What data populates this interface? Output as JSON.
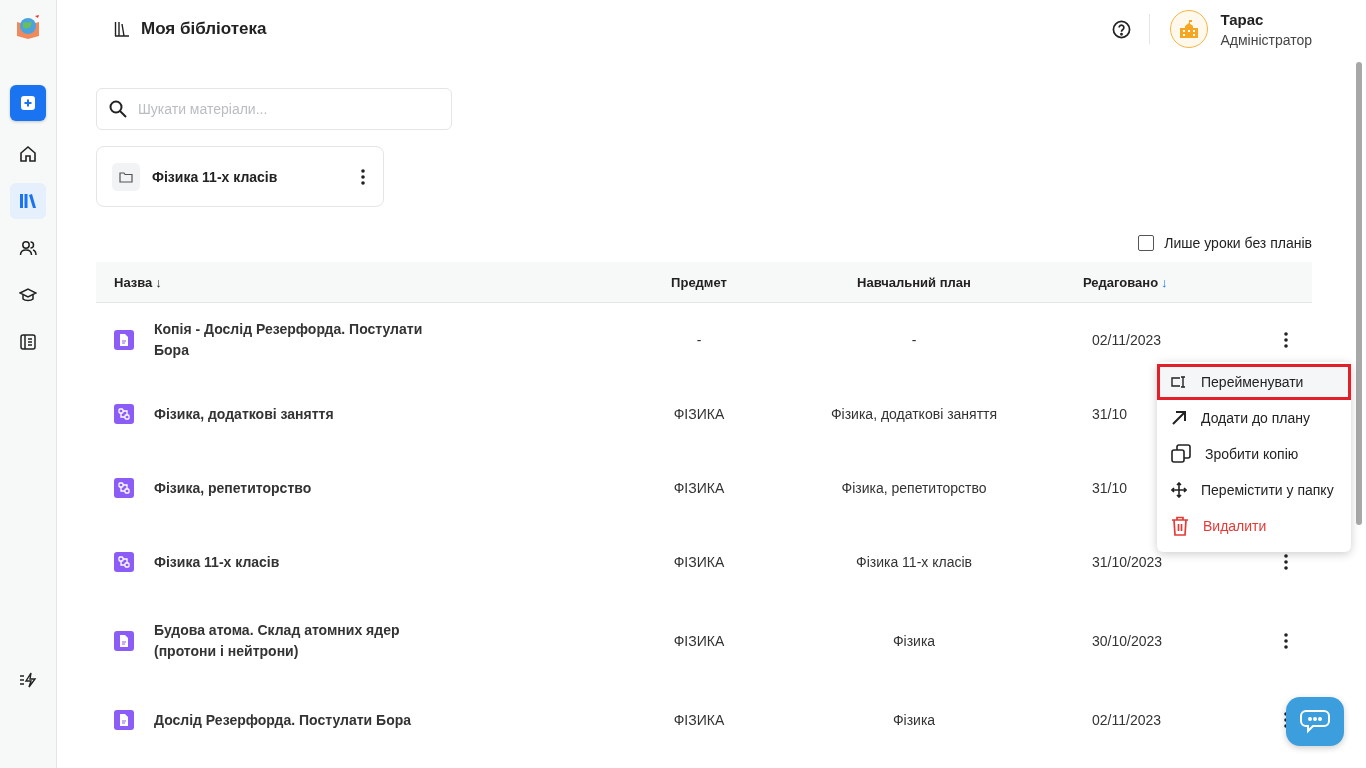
{
  "header": {
    "title": "Моя бібліотека",
    "user": {
      "name": "Тарас",
      "role": "Адміністратор"
    }
  },
  "sidebar": {
    "items": [
      {
        "kind": "add",
        "selected": false
      },
      {
        "kind": "home",
        "selected": false
      },
      {
        "kind": "library",
        "selected": true
      },
      {
        "kind": "users",
        "selected": false
      },
      {
        "kind": "courses",
        "selected": false
      },
      {
        "kind": "journal",
        "selected": false
      }
    ]
  },
  "search": {
    "placeholder": "Шукати матеріали..."
  },
  "folders": [
    {
      "name": "Фізика 11-х класів"
    }
  ],
  "filter": {
    "label": "Лише уроки без планів",
    "checked": false
  },
  "table": {
    "columns": [
      {
        "label": "Назва",
        "sort_arrow": "↓",
        "active": false
      },
      {
        "label": "Предмет"
      },
      {
        "label": "Навчальний план"
      },
      {
        "label": "Редаговано",
        "sort_arrow": "↓",
        "active": true
      }
    ],
    "rows": [
      {
        "kind": "doc",
        "name": "Копія - Дослід Резерфорда. Постулати Бора",
        "subject": "-",
        "plan": "-",
        "edited": "02/11/2023"
      },
      {
        "kind": "plan",
        "name": "Фізика, додаткові заняття",
        "subject": "ФІЗИКА",
        "plan": "Фізика, додаткові заняття",
        "edited": "31/10"
      },
      {
        "kind": "plan",
        "name": "Фізика, репетиторство",
        "subject": "ФІЗИКА",
        "plan": "Фізика, репетиторство",
        "edited": "31/10"
      },
      {
        "kind": "plan",
        "name": "Фізика 11-х класів",
        "subject": "ФІЗИКА",
        "plan": "Фізика 11-х класів",
        "edited": "31/10/2023"
      },
      {
        "kind": "doc",
        "name": "Будова атома. Склад атомних ядер (протони і нейтрони)",
        "subject": "ФІЗИКА",
        "plan": "Фізика",
        "edited": "30/10/2023"
      },
      {
        "kind": "doc",
        "name": "Дослід Резерфорда. Постулати Бора",
        "subject": "ФІЗИКА",
        "plan": "Фізика",
        "edited": "02/11/2023"
      }
    ]
  },
  "context_menu": {
    "items": [
      {
        "kind": "rename",
        "label": "Перейменувати",
        "selected": true
      },
      {
        "kind": "add",
        "label": "Додати до плану",
        "selected": false
      },
      {
        "kind": "copy",
        "label": "Зробити копію",
        "selected": false
      },
      {
        "kind": "move",
        "label": "Перемістити у папку",
        "selected": false
      },
      {
        "kind": "delete",
        "label": "Видалити",
        "selected": false
      }
    ]
  }
}
